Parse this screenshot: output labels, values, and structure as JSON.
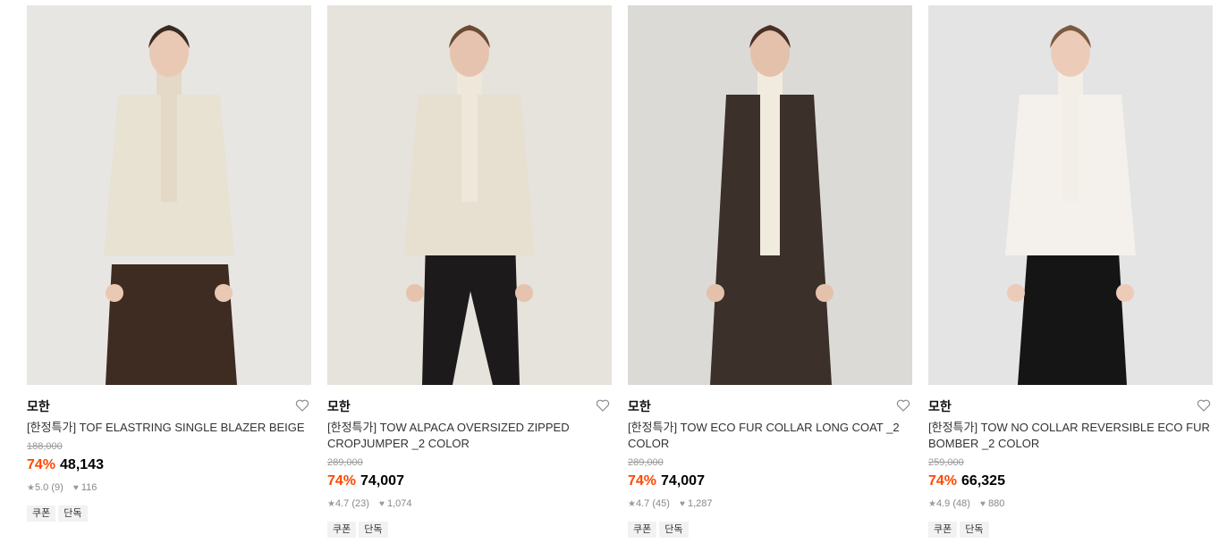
{
  "products": [
    {
      "brand": "모한",
      "title": "[한정특가] TOF ELASTRING SINGLE BLAZER BEIGE",
      "original_price": "188,000",
      "discount": "74%",
      "price": "48,143",
      "rating": "5.0 (9)",
      "likes": "116",
      "tags": [
        "쿠폰",
        "단독"
      ],
      "image": {
        "bg": "#e8e6e3",
        "top": "#e8e2d3",
        "inner": "#e4d8c6",
        "bottom": "#3e2b22",
        "skin": "#e9c9b3",
        "hair": "#3a2b22"
      }
    },
    {
      "brand": "모한",
      "title": "[한정특가] TOW ALPACA OVERSIZED ZIPPED CROPJUMPER _2 COLOR",
      "original_price": "289,000",
      "discount": "74%",
      "price": "74,007",
      "rating": "4.7 (23)",
      "likes": "1,074",
      "tags": [
        "쿠폰",
        "단독"
      ],
      "image": {
        "bg": "#e6e2dc",
        "top": "#e7dfd0",
        "inner": "#efe7da",
        "bottom": "#1c1a1b",
        "skin": "#e6c3ae",
        "hair": "#6b4a36"
      }
    },
    {
      "brand": "모한",
      "title": "[한정특가] TOW ECO FUR COLLAR LONG COAT _2 COLOR",
      "original_price": "289,000",
      "discount": "74%",
      "price": "74,007",
      "rating": "4.7 (45)",
      "likes": "1,287",
      "tags": [
        "쿠폰",
        "단독"
      ],
      "image": {
        "bg": "#dcdad7",
        "top": "#3b302a",
        "inner": "#f1ebdf",
        "bottom": "#2f2520",
        "skin": "#e3c1ab",
        "hair": "#4a3024"
      }
    },
    {
      "brand": "모한",
      "title": "[한정특가] TOW NO COLLAR REVERSIBLE ECO FUR BOMBER _2 COLOR",
      "original_price": "259,000",
      "discount": "74%",
      "price": "66,325",
      "rating": "4.9 (48)",
      "likes": "880",
      "tags": [
        "쿠폰",
        "단독"
      ],
      "image": {
        "bg": "#e4e4e4",
        "top": "#f4f1ec",
        "inner": "#f3efe8",
        "bottom": "#151515",
        "skin": "#ecccb9",
        "hair": "#7a5a42"
      }
    }
  ],
  "icons": {
    "heart": "heart-outline-icon",
    "star": "star-icon",
    "like": "heart-filled-icon"
  }
}
